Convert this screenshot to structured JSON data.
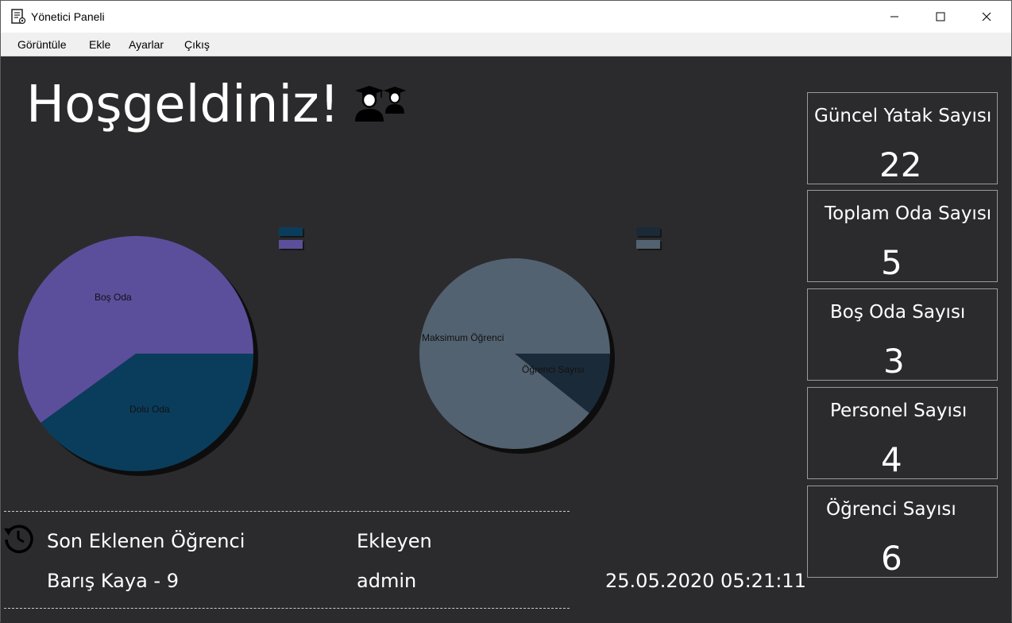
{
  "window": {
    "title": "Yönetici Paneli",
    "controls": [
      "minimize",
      "maximize",
      "close"
    ]
  },
  "menu": {
    "items": [
      "Görüntüle",
      "Ekle",
      "Ayarlar",
      "Çıkış"
    ]
  },
  "main": {
    "welcome": "Hoşgeldiniz!",
    "welcome_icon": "graduates-icon"
  },
  "chart_data": [
    {
      "type": "pie",
      "categories": [
        "Dolu Oda",
        "Boş Oda"
      ],
      "values": [
        2,
        3
      ],
      "colors": [
        "#0a3d5c",
        "#5b4f9b"
      ],
      "legend_position": "top-right"
    },
    {
      "type": "pie",
      "categories": [
        "Öğrenci Sayısı",
        "Maksimum Öğrenci"
      ],
      "values": [
        6,
        50
      ],
      "colors": [
        "#1b2a38",
        "#536271"
      ],
      "legend_position": "top-right"
    }
  ],
  "last_added": {
    "header_student": "Son Eklenen Öğrenci",
    "header_by": "Ekleyen",
    "student": "Barış Kaya - 9",
    "by": "admin",
    "datetime": "25.05.2020 05:21:11",
    "icon": "history-icon"
  },
  "stats": [
    {
      "title": "Güncel Yatak Sayısı",
      "value": "22"
    },
    {
      "title": "Toplam Oda Sayısı",
      "value": "5"
    },
    {
      "title": "Boş Oda Sayısı",
      "value": "3"
    },
    {
      "title": "Personel Sayısı",
      "value": "4"
    },
    {
      "title": "Öğrenci Sayısı",
      "value": "6"
    }
  ]
}
